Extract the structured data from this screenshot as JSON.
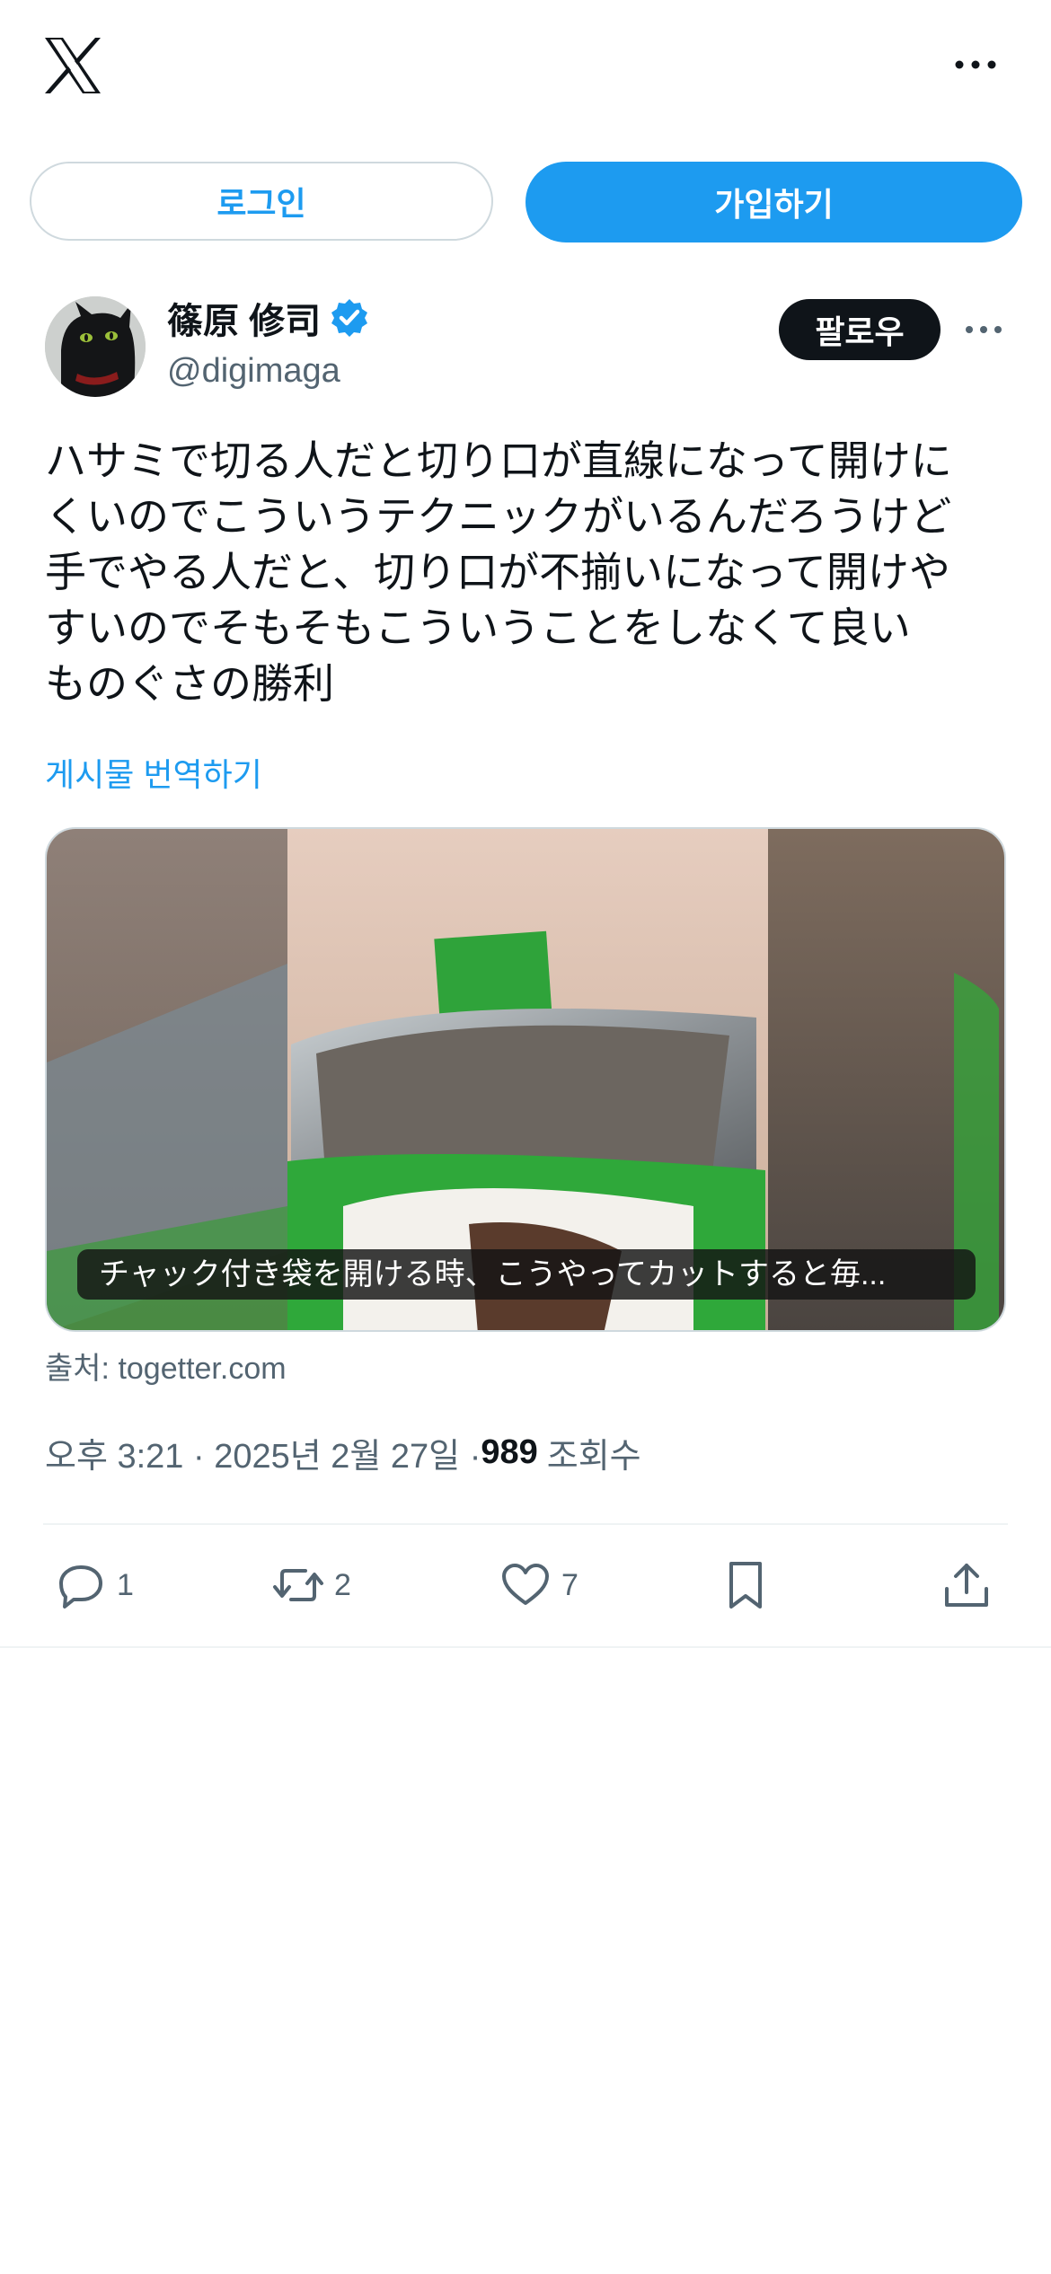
{
  "header": {
    "logo_icon": "x-logo-icon",
    "more_icon": "more-horizontal-icon"
  },
  "auth": {
    "login_label": "로그인",
    "signup_label": "가입하기"
  },
  "post": {
    "author": {
      "display_name": "篠原 修司",
      "handle": "@digimaga",
      "verified": true
    },
    "follow_label": "팔로우",
    "text": "ハサミで切る人だと切り口が直線になって開けに\nくいのでこういうテクニックがいるんだろうけど\n手でやる人だと、切り口が不揃いになって開けや\nすいのでそもそもこういうことをしなくて良い\nものぐさの勝利",
    "translate_label": "게시물 번역하기",
    "media": {
      "caption": "チャック付き袋を開ける時、こうやってカットすると毎..."
    },
    "source": "출처: togetter.com",
    "timestamp": "오후 3:21 · 2025년 2월 27일 · ",
    "views_count": "989",
    "views_label": "조회수",
    "stats": {
      "replies": "1",
      "reposts": "2",
      "likes": "7"
    }
  },
  "colors": {
    "accent": "#1d9bf0",
    "text": "#0f1419",
    "secondary": "#536471",
    "border": "#cfd9de"
  }
}
